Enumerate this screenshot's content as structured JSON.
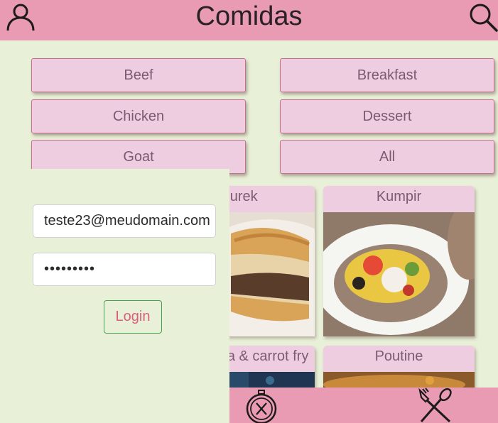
{
  "header": {
    "title": "Comidas",
    "profile_icon": "profile-icon",
    "search_icon": "search-icon"
  },
  "categories": [
    {
      "label": "Beef"
    },
    {
      "label": "Breakfast"
    },
    {
      "label": "Chicken"
    },
    {
      "label": "Dessert"
    },
    {
      "label": "Goat"
    },
    {
      "label": "All"
    }
  ],
  "meals": [
    {
      "name": "Burek"
    },
    {
      "name": "Kumpir"
    },
    {
      "name": "Sugar pea & carrot fry"
    },
    {
      "name": "Poutine"
    }
  ],
  "login": {
    "email_value": "teste23@meudomain.com",
    "password_value": "•••••••••",
    "button_label": "Login"
  },
  "footer": {
    "explore_icon": "compass-icon",
    "meals_icon": "fork-knife-icon"
  },
  "colors": {
    "background": "#e9f0d8",
    "header": "#e89bb3",
    "button": "#eecde1",
    "login_border": "#45a04d",
    "login_text": "#d8607e"
  }
}
